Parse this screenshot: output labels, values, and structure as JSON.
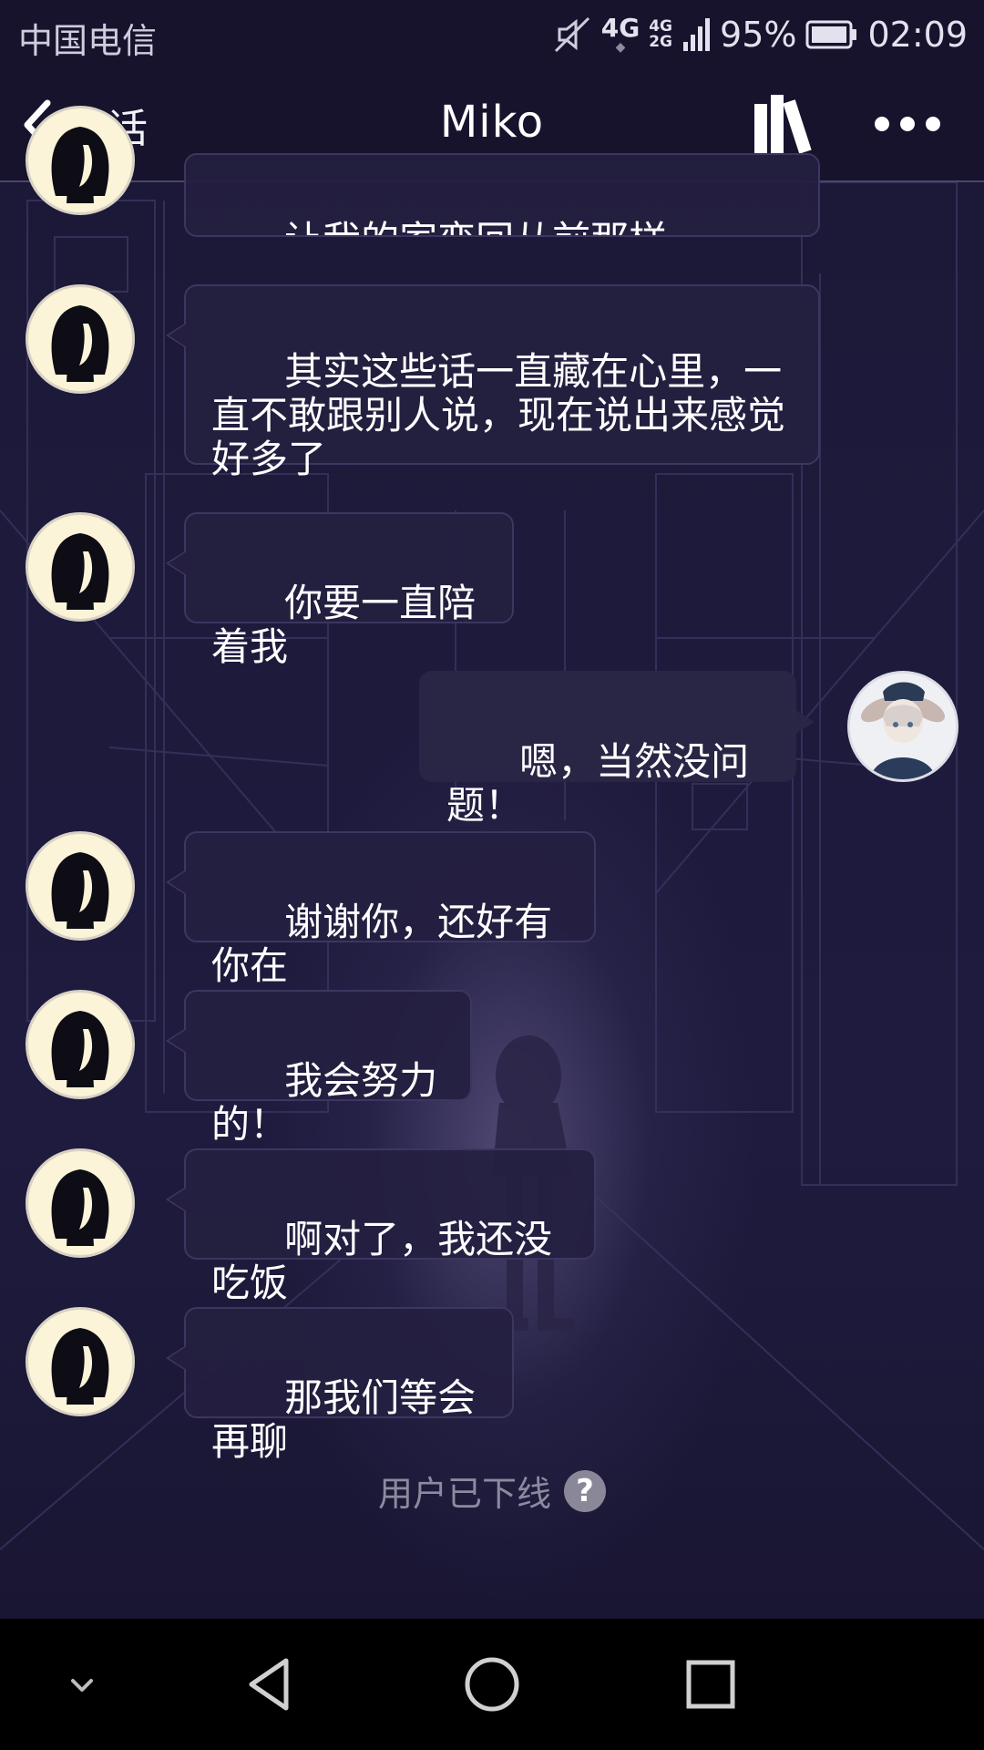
{
  "status_bar": {
    "carrier": "中国电信",
    "network_1": "4G",
    "network_2": "4G",
    "network_3": "2G",
    "battery": "95%",
    "time": "02:09"
  },
  "header": {
    "back_label": "会话",
    "title": "Miko"
  },
  "messages": [
    {
      "side": "left",
      "text": "让我的家变回从前那样"
    },
    {
      "side": "left",
      "text": "其实这些话一直藏在心里，一直不敢跟别人说，现在说出来感觉好多了"
    },
    {
      "side": "left",
      "text": "你要一直陪着我"
    },
    {
      "side": "right",
      "text": "嗯，当然没问题！"
    },
    {
      "side": "left",
      "text": "谢谢你，还好有你在"
    },
    {
      "side": "left",
      "text": "我会努力的！"
    },
    {
      "side": "left",
      "text": "啊对了，我还没吃饭"
    },
    {
      "side": "left",
      "text": "那我们等会再聊"
    }
  ],
  "footer_status": {
    "text": "用户已下线",
    "help_glyph": "?"
  },
  "icons": [
    "mute-icon",
    "signal-icon",
    "battery-icon",
    "back-chevron-icon",
    "books-icon",
    "more-icon",
    "help-icon",
    "nav-collapse-icon",
    "nav-back-icon",
    "nav-home-icon",
    "nav-recents-icon"
  ]
}
